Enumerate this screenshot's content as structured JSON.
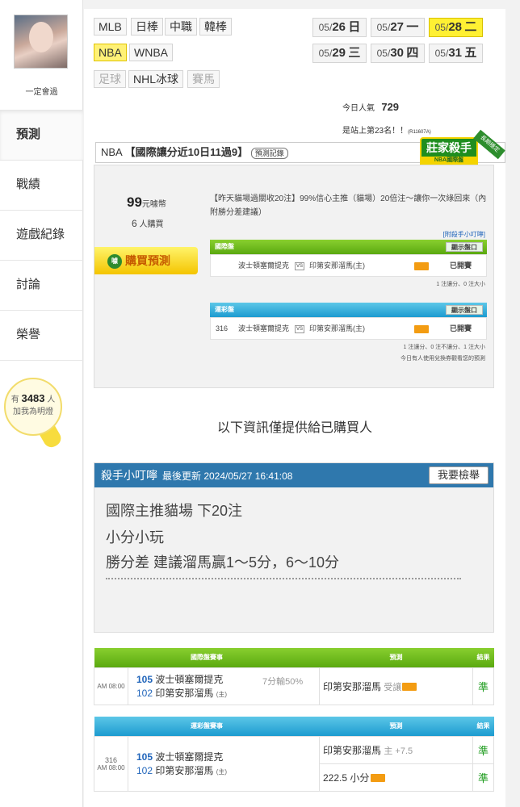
{
  "user": {
    "name": "一定會過",
    "avatar_icon": "profile-photo"
  },
  "sidebar": {
    "items": [
      {
        "label": "預測",
        "active": true
      },
      {
        "label": "戰績"
      },
      {
        "label": "遊戲紀錄"
      },
      {
        "label": "討論"
      },
      {
        "label": "榮譽"
      }
    ],
    "lamp": {
      "prefix": "有",
      "count": "3483",
      "suffix": "人",
      "sub": "加我為明燈",
      "icon": "light-bulb-icon"
    }
  },
  "leagues": {
    "row1": [
      "MLB",
      "日棒",
      "中職",
      "韓棒"
    ],
    "row2": [
      "NBA",
      "WNBA"
    ],
    "row3": [
      "足球",
      "NHL冰球",
      "賽馬"
    ],
    "selected": "NBA"
  },
  "dates": [
    {
      "d": "05/",
      "n": "26",
      "w": "日"
    },
    {
      "d": "05/",
      "n": "27",
      "w": "一"
    },
    {
      "d": "05/",
      "n": "28",
      "w": "二",
      "sel": true
    },
    {
      "d": "05/",
      "n": "29",
      "w": "三"
    },
    {
      "d": "05/",
      "n": "30",
      "w": "四"
    },
    {
      "d": "05/",
      "n": "31",
      "w": "五"
    }
  ],
  "popularity": {
    "label": "今日人氣",
    "value": "729",
    "rank": "是站上第23名！！",
    "code": "(R11607A)"
  },
  "title": {
    "league": "NBA",
    "headline": "【國際讓分近10日11過9】",
    "record_btn": "預測記錄"
  },
  "badge": {
    "main": "莊家殺手",
    "sub": "NBA國際盤",
    "ribbon": "長期穩定"
  },
  "pick": {
    "price": "99",
    "price_unit": "元噱幣",
    "buyers": "6",
    "buyers_unit": "人購買",
    "buy_label": "購買預測",
    "coin": "噱",
    "desc": "【昨天貓場過關收20注】99%信心主推（貓場）20倍注～讓你一次綠回來（內附勝分差建議）",
    "link": "[附殺手小叮嚀]",
    "intl": {
      "header": "國際盤",
      "show": "顯示盤口",
      "away": "波士頓塞爾提克",
      "vs": "VS",
      "home": "印第安那溜馬(主)",
      "status": "已開賽",
      "note": "1 注讓分、0 注大小"
    },
    "sport": {
      "header": "運彩盤",
      "show": "顯示盤口",
      "no": "316",
      "away": "波士頓塞爾提克",
      "vs": "VS",
      "home": "印第安那溜馬(主)",
      "status": "已開賽",
      "note": "1 注讓分、0 注不讓分、1 注大小"
    },
    "footnote": "今日有人使用兌換券觀看您的預測"
  },
  "info": "以下資訊僅提供給已購買人",
  "tips": {
    "title": "殺手小叮嚀",
    "updated": "最後更新 2024/05/27 16:41:08",
    "report": "我要檢舉",
    "lines": [
      "國際主推貓場 下20注",
      "小分小玩",
      "勝分差 建議溜馬贏1～5分，6～10分"
    ]
  },
  "results": {
    "intl": {
      "headers": [
        "國際盤賽事",
        "預測",
        "結果"
      ],
      "time": "AM 08:00",
      "away_no": "105",
      "away": "波士頓塞爾提克",
      "home_no": "102",
      "home": "印第安那溜馬",
      "home_tag": "(主)",
      "line": "7分輸50%",
      "pick": "印第安那溜馬",
      "pick_tag": "受讓",
      "result": "準"
    },
    "sport": {
      "headers": [
        "運彩盤賽事",
        "預測",
        "結果"
      ],
      "no": "316",
      "time": "AM 08:00",
      "away_no": "105",
      "away": "波士頓塞爾提克",
      "home_no": "102",
      "home": "印第安那溜馬",
      "home_tag": "(主)",
      "pick1": "印第安那溜馬",
      "pick1_tag": "主 +7.5",
      "result1": "準",
      "pick2": "222.5 小分",
      "result2": "準"
    }
  }
}
